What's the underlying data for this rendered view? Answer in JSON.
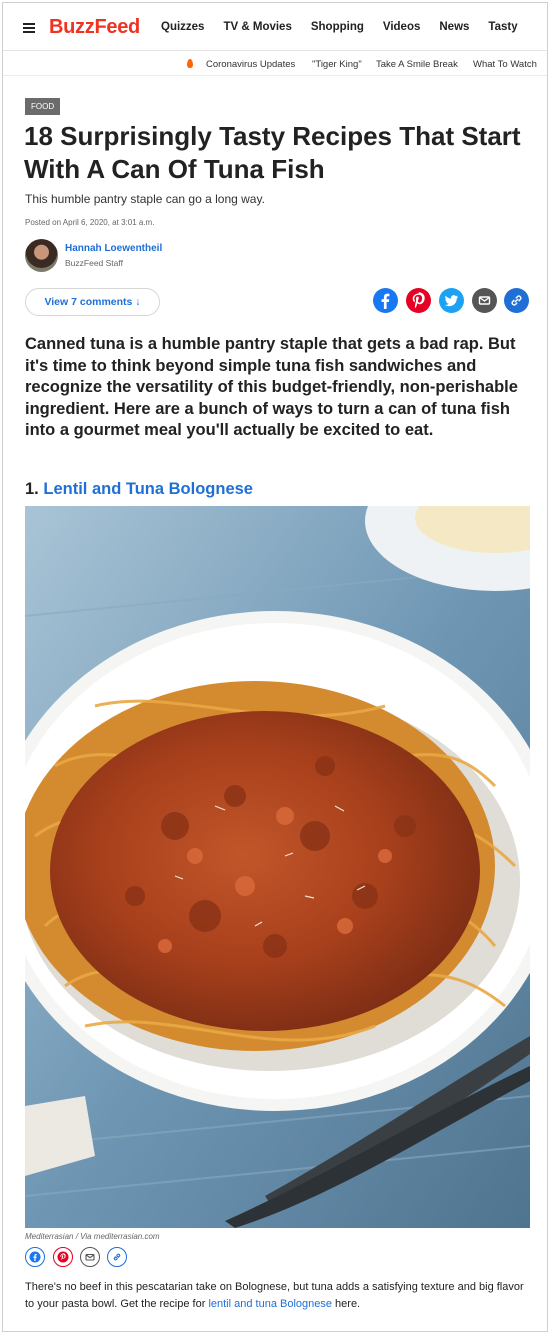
{
  "header": {
    "logo": "BuzzFeed",
    "nav": [
      "Quizzes",
      "TV & Movies",
      "Shopping",
      "Videos",
      "News",
      "Tasty"
    ],
    "trending": [
      "Coronavirus Updates",
      "\"Tiger King\"",
      "Take A Smile Break",
      "What To Watch"
    ]
  },
  "article": {
    "category": "FOOD",
    "title": "18 Surprisingly Tasty Recipes That Start With A Can Of Tuna Fish",
    "dek": "This humble pantry staple can go a long way.",
    "posted": "Posted on April 6, 2020, at 3:01 a.m.",
    "author_name": "Hannah Loewentheil",
    "author_role": "BuzzFeed Staff",
    "comments_label": "View 7 comments ↓",
    "intro": "Canned tuna is a humble pantry staple that gets a bad rap. But it's time to think beyond simple tuna fish sandwiches and recognize the versatility of this budget-friendly, non-perishable ingredient. Here are a bunch of ways to turn a can of tuna fish into a gourmet meal you'll actually be excited to eat."
  },
  "share_colors": {
    "facebook": "#1877f2",
    "pinterest": "#e60023",
    "twitter": "#1da1f2",
    "email": "#555555",
    "link": "#1f6fd6"
  },
  "items": [
    {
      "number": "1.",
      "title": "Lentil and Tuna Bolognese",
      "credit": "Mediterrasian / Via mediterrasian.com",
      "body_before": "There's no beef in this pescatarian take on Bolognese, but tuna adds a satisfying texture and big flavor to your pasta bowl. Get the recipe for ",
      "body_link": "lentil and tuna Bolognese",
      "body_after": " here."
    }
  ]
}
